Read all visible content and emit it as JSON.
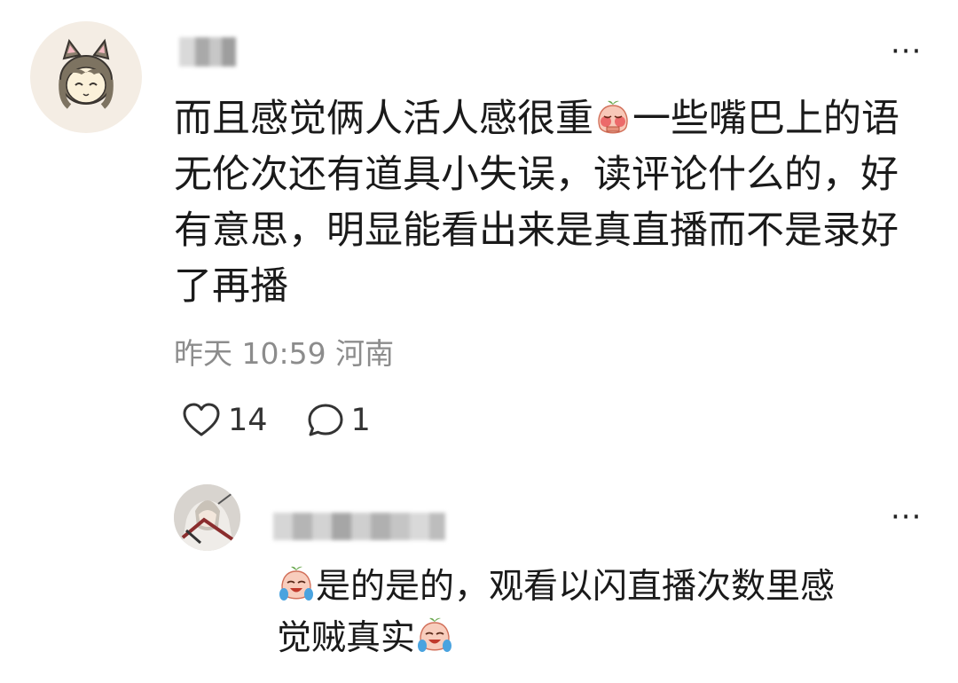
{
  "comment": {
    "username_hidden": true,
    "text_part1": "而且感觉俩人活人感很重",
    "emoji1": "embarrassed-peach-emoji",
    "text_part2": "一些嘴巴上的语\n无伦次还有道具小失误，读评论什么的，好\n有意思，明显能看出来是真直播而不是录好\n了再播",
    "time": "昨天 10:59",
    "location": "河南",
    "likes": "14",
    "replies": "1",
    "more_label": "···"
  },
  "reply": {
    "username_hidden": true,
    "emoji_start": "crying-laughing-peach-emoji",
    "text_part1": "是的是的，观看以闪直播次数里感\n觉贼真实",
    "emoji_end": "crying-laughing-peach-emoji",
    "more_label": "···"
  },
  "colors": {
    "text": "#1a1a1a",
    "meta": "#8c8c8c",
    "avatar_bg": "#f4ede4"
  }
}
